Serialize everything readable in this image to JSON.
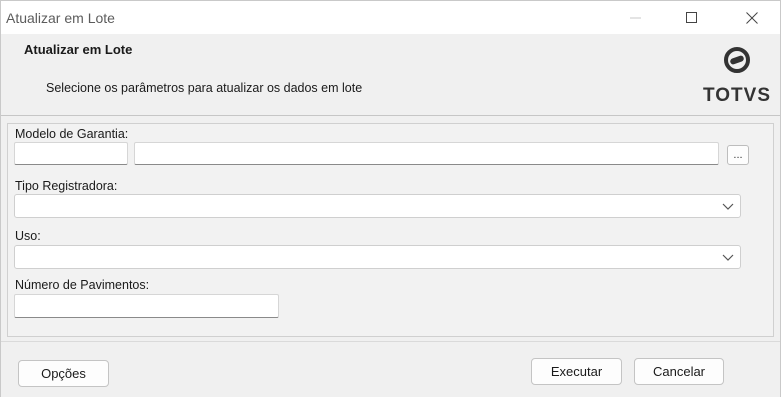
{
  "window": {
    "title": "Atualizar em Lote",
    "controls": {
      "minimize_icon": "minimize-icon",
      "maximize_icon": "maximize-icon",
      "close_icon": "close-icon"
    }
  },
  "header": {
    "title": "Atualizar em Lote",
    "subtitle": "Selecione os parâmetros para atualizar os dados em lote",
    "logo_text": "TOTVS"
  },
  "form": {
    "modelo_garantia": {
      "label": "Modelo de Garantia:",
      "code_value": "",
      "description_value": "",
      "lookup_label": "..."
    },
    "tipo_registradora": {
      "label": "Tipo Registradora:",
      "selected": ""
    },
    "uso": {
      "label": "Uso:",
      "selected": ""
    },
    "numero_pavimentos": {
      "label": "Número de Pavimentos:",
      "value": ""
    }
  },
  "footer": {
    "options_label": "Opções",
    "execute_label": "Executar",
    "cancel_label": "Cancelar"
  },
  "colors": {
    "window_bg": "#f0f0f0",
    "titlebar_bg": "#ffffff",
    "field_bg": "#ffffff",
    "border": "#c9c9c9"
  }
}
